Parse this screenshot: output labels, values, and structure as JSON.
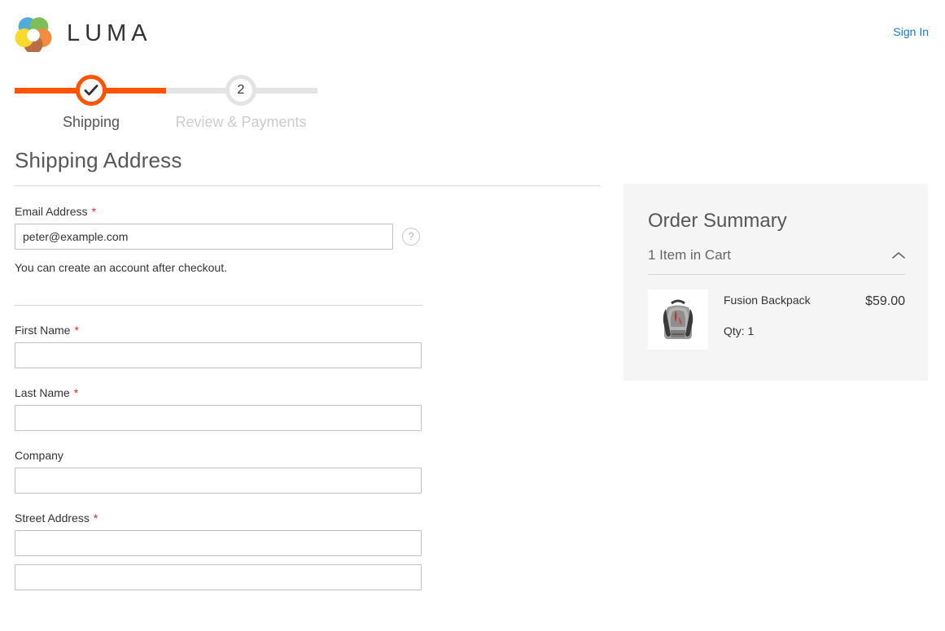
{
  "header": {
    "logo_name": "luma-logo",
    "brand": "LUMA",
    "sign_in_label": "Sign In",
    "link_color": "#1979c3"
  },
  "progress": {
    "accent_color": "#ff5501",
    "track_color": "#e4e4e4",
    "steps": [
      {
        "label": "Shipping",
        "marker": "check",
        "state": "complete"
      },
      {
        "label": "Review & Payments",
        "marker": "2",
        "state": "upcoming"
      }
    ]
  },
  "page": {
    "title": "Shipping Address"
  },
  "form": {
    "email": {
      "label": "Email Address",
      "required": true,
      "required_mark": "*",
      "value": "peter@example.com",
      "placeholder": "",
      "tooltip_icon": "question-mark-icon",
      "hint": "You can create an account after checkout."
    },
    "fields": [
      {
        "name": "first-name",
        "label": "First Name",
        "required": true,
        "required_mark": "*",
        "value": "",
        "placeholder": ""
      },
      {
        "name": "last-name",
        "label": "Last Name",
        "required": true,
        "required_mark": "*",
        "value": "",
        "placeholder": ""
      },
      {
        "name": "company",
        "label": "Company",
        "required": false,
        "required_mark": "",
        "value": "",
        "placeholder": ""
      },
      {
        "name": "street-address",
        "label": "Street Address",
        "required": true,
        "required_mark": "*",
        "value": "",
        "placeholder": ""
      },
      {
        "name": "street-address-line-2",
        "label": "",
        "required": false,
        "required_mark": "",
        "value": "",
        "placeholder": ""
      }
    ]
  },
  "order_summary": {
    "title": "Order Summary",
    "items_toggle_label": "1 Item in Cart",
    "toggle_icon": "chevron-up-icon",
    "background": "#f5f5f5",
    "items": [
      {
        "name": "Fusion Backpack",
        "price": "$59.00",
        "qty_label": "Qty: 1",
        "thumb_name": "product-thumbnail-fusion-backpack"
      }
    ]
  }
}
